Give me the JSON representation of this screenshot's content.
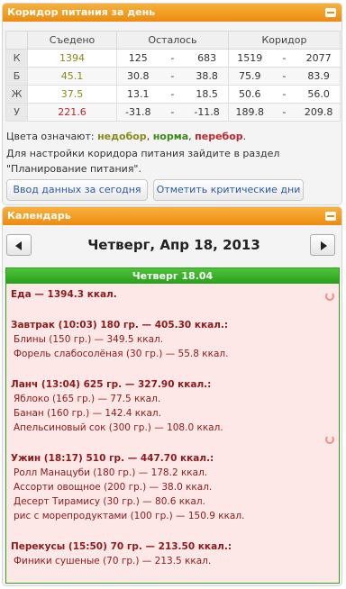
{
  "corridor": {
    "title": "Коридор питания за день",
    "headers": {
      "eaten": "Съедено",
      "remaining": "Осталось",
      "corridor": "Коридор"
    },
    "rows": [
      {
        "label": "К",
        "eaten": "1394",
        "eaten_color": "under",
        "rem_lo": "125",
        "rem_hi": "683",
        "cor_lo": "1519",
        "cor_hi": "2077"
      },
      {
        "label": "Б",
        "eaten": "45.1",
        "eaten_color": "under",
        "rem_lo": "30.8",
        "rem_hi": "38.8",
        "cor_lo": "75.9",
        "cor_hi": "83.9"
      },
      {
        "label": "Ж",
        "eaten": "37.5",
        "eaten_color": "under",
        "rem_lo": "13.1",
        "rem_hi": "18.5",
        "cor_lo": "50.6",
        "cor_hi": "56.0"
      },
      {
        "label": "У",
        "eaten": "221.6",
        "eaten_color": "over",
        "rem_lo": "-31.8",
        "rem_hi": "-11.8",
        "cor_lo": "189.8",
        "cor_hi": "209.8"
      }
    ],
    "dash": "-",
    "legend_prefix": "Цвета означают: ",
    "legend_under": "недобор",
    "legend_norm": "норма",
    "legend_over": "перебор",
    "legend_sep": ", ",
    "legend_end": ".",
    "hint": "Для настройки коридора питания зайдите в раздел \"Планирование питания\".",
    "btn_input": "Ввод данных за сегодня",
    "btn_critical": "Отметить критические дни",
    "colors": {
      "under": "#8a8a1a",
      "norm": "#3a8a1a",
      "over": "#c0262a"
    }
  },
  "calendar": {
    "title": "Календарь",
    "date": "Четверг, Апр 18, 2013",
    "day_header": "Четверг 18.04",
    "food_total": "Еда — 1394.3 ккал.",
    "meals": [
      {
        "title": "Завтрак (10:03) 180 гр. — 405.30 ккал.:",
        "items": [
          "Блины (150 гр.) — 349.5 ккал.",
          "Форель слабосолёная (30 гр.) — 55.8 ккал."
        ]
      },
      {
        "title": "Ланч (13:04) 625 гр. — 327.90 ккал.:",
        "items": [
          "Яблоко (165 гр.) — 77.5 ккал.",
          "Банан (160 гр.) — 142.4 ккал.",
          "Апельсиновый сок (300 гр.) — 108.0 ккал."
        ]
      },
      {
        "title": "Ужин (18:17) 510 гр. — 447.70 ккал.:",
        "items": [
          "Ролл Манацуби (180 гр.) — 178.2 ккал.",
          "Ассорти овощное (200 гр.) — 38.0 ккал.",
          "Десерт Тирамису (30 гр.) — 80.6 ккал.",
          "рис с морепродуктами (100 гр.) — 150.9 ккал."
        ]
      },
      {
        "title": "Перекусы (15:50) 70 гр. — 213.50 ккал.:",
        "items": [
          "Финики сушеные (70 гр.) — 213.5 ккал."
        ]
      }
    ]
  }
}
